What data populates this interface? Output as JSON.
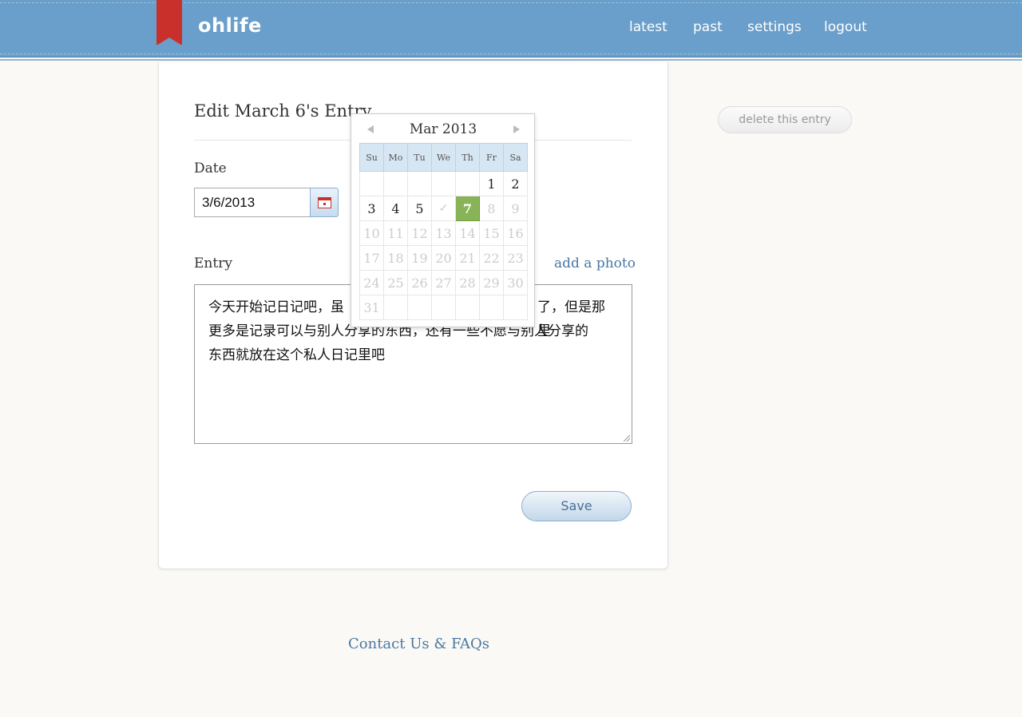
{
  "header": {
    "logo": "ohlife",
    "nav": [
      "latest",
      "past",
      "settings",
      "logout"
    ]
  },
  "form": {
    "title": "Edit March 6's Entry",
    "date_label": "Date",
    "date_value": "3/6/2013",
    "entry_label": "Entry",
    "add_photo": "add a photo",
    "entry_text_lines": [
      "今天开始记日记吧，虽",
      "更多是记录可以与别人分享的东西，还有一些不愿与别人分享的",
      "东西就放在这个私人日记里吧"
    ],
    "entry_text_right": "了，但是那里",
    "save_label": "Save"
  },
  "sidebar": {
    "delete_label": "delete this entry"
  },
  "footer": {
    "contact": "Contact Us & FAQs"
  },
  "datepicker": {
    "title": "Mar 2013",
    "weekdays": [
      "Su",
      "Mo",
      "Tu",
      "We",
      "Th",
      "Fr",
      "Sa"
    ],
    "weeks": [
      [
        "",
        "",
        "",
        "",
        "",
        "1",
        "2"
      ],
      [
        "3",
        "4",
        "5",
        "✓",
        "7",
        "8",
        "9"
      ],
      [
        "10",
        "11",
        "12",
        "13",
        "14",
        "15",
        "16"
      ],
      [
        "17",
        "18",
        "19",
        "20",
        "21",
        "22",
        "23"
      ],
      [
        "24",
        "25",
        "26",
        "27",
        "28",
        "29",
        "30"
      ],
      [
        "31",
        "",
        "",
        "",
        "",
        "",
        ""
      ]
    ],
    "today": "7",
    "enabled_through": "7"
  }
}
